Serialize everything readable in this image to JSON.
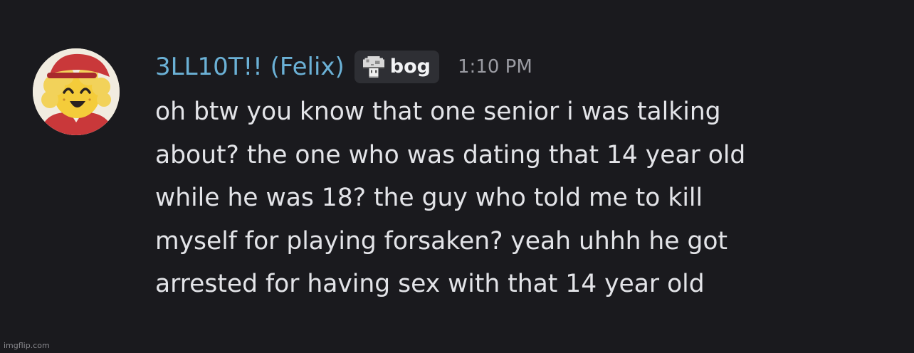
{
  "message": {
    "author": "3LL10T!! (Felix)",
    "tag": {
      "icon": "mushroom-pixel-icon",
      "label": "bog"
    },
    "timestamp": "1:10 PM",
    "lines": [
      "oh btw you know that one senior i was talking",
      "about? the one who was dating that 14 year old",
      "while he was 18? the guy who told me to kill",
      "myself for playing forsaken? yeah uhhh he got",
      "arrested for having sex with that 14 year old"
    ]
  },
  "watermark": "imgflip.com",
  "colors": {
    "background": "#1a1a1e",
    "username": "#6bb1d6",
    "text": "#e3e4e8",
    "timestamp": "#9a9ba2",
    "tag_background": "#2e2f34"
  }
}
